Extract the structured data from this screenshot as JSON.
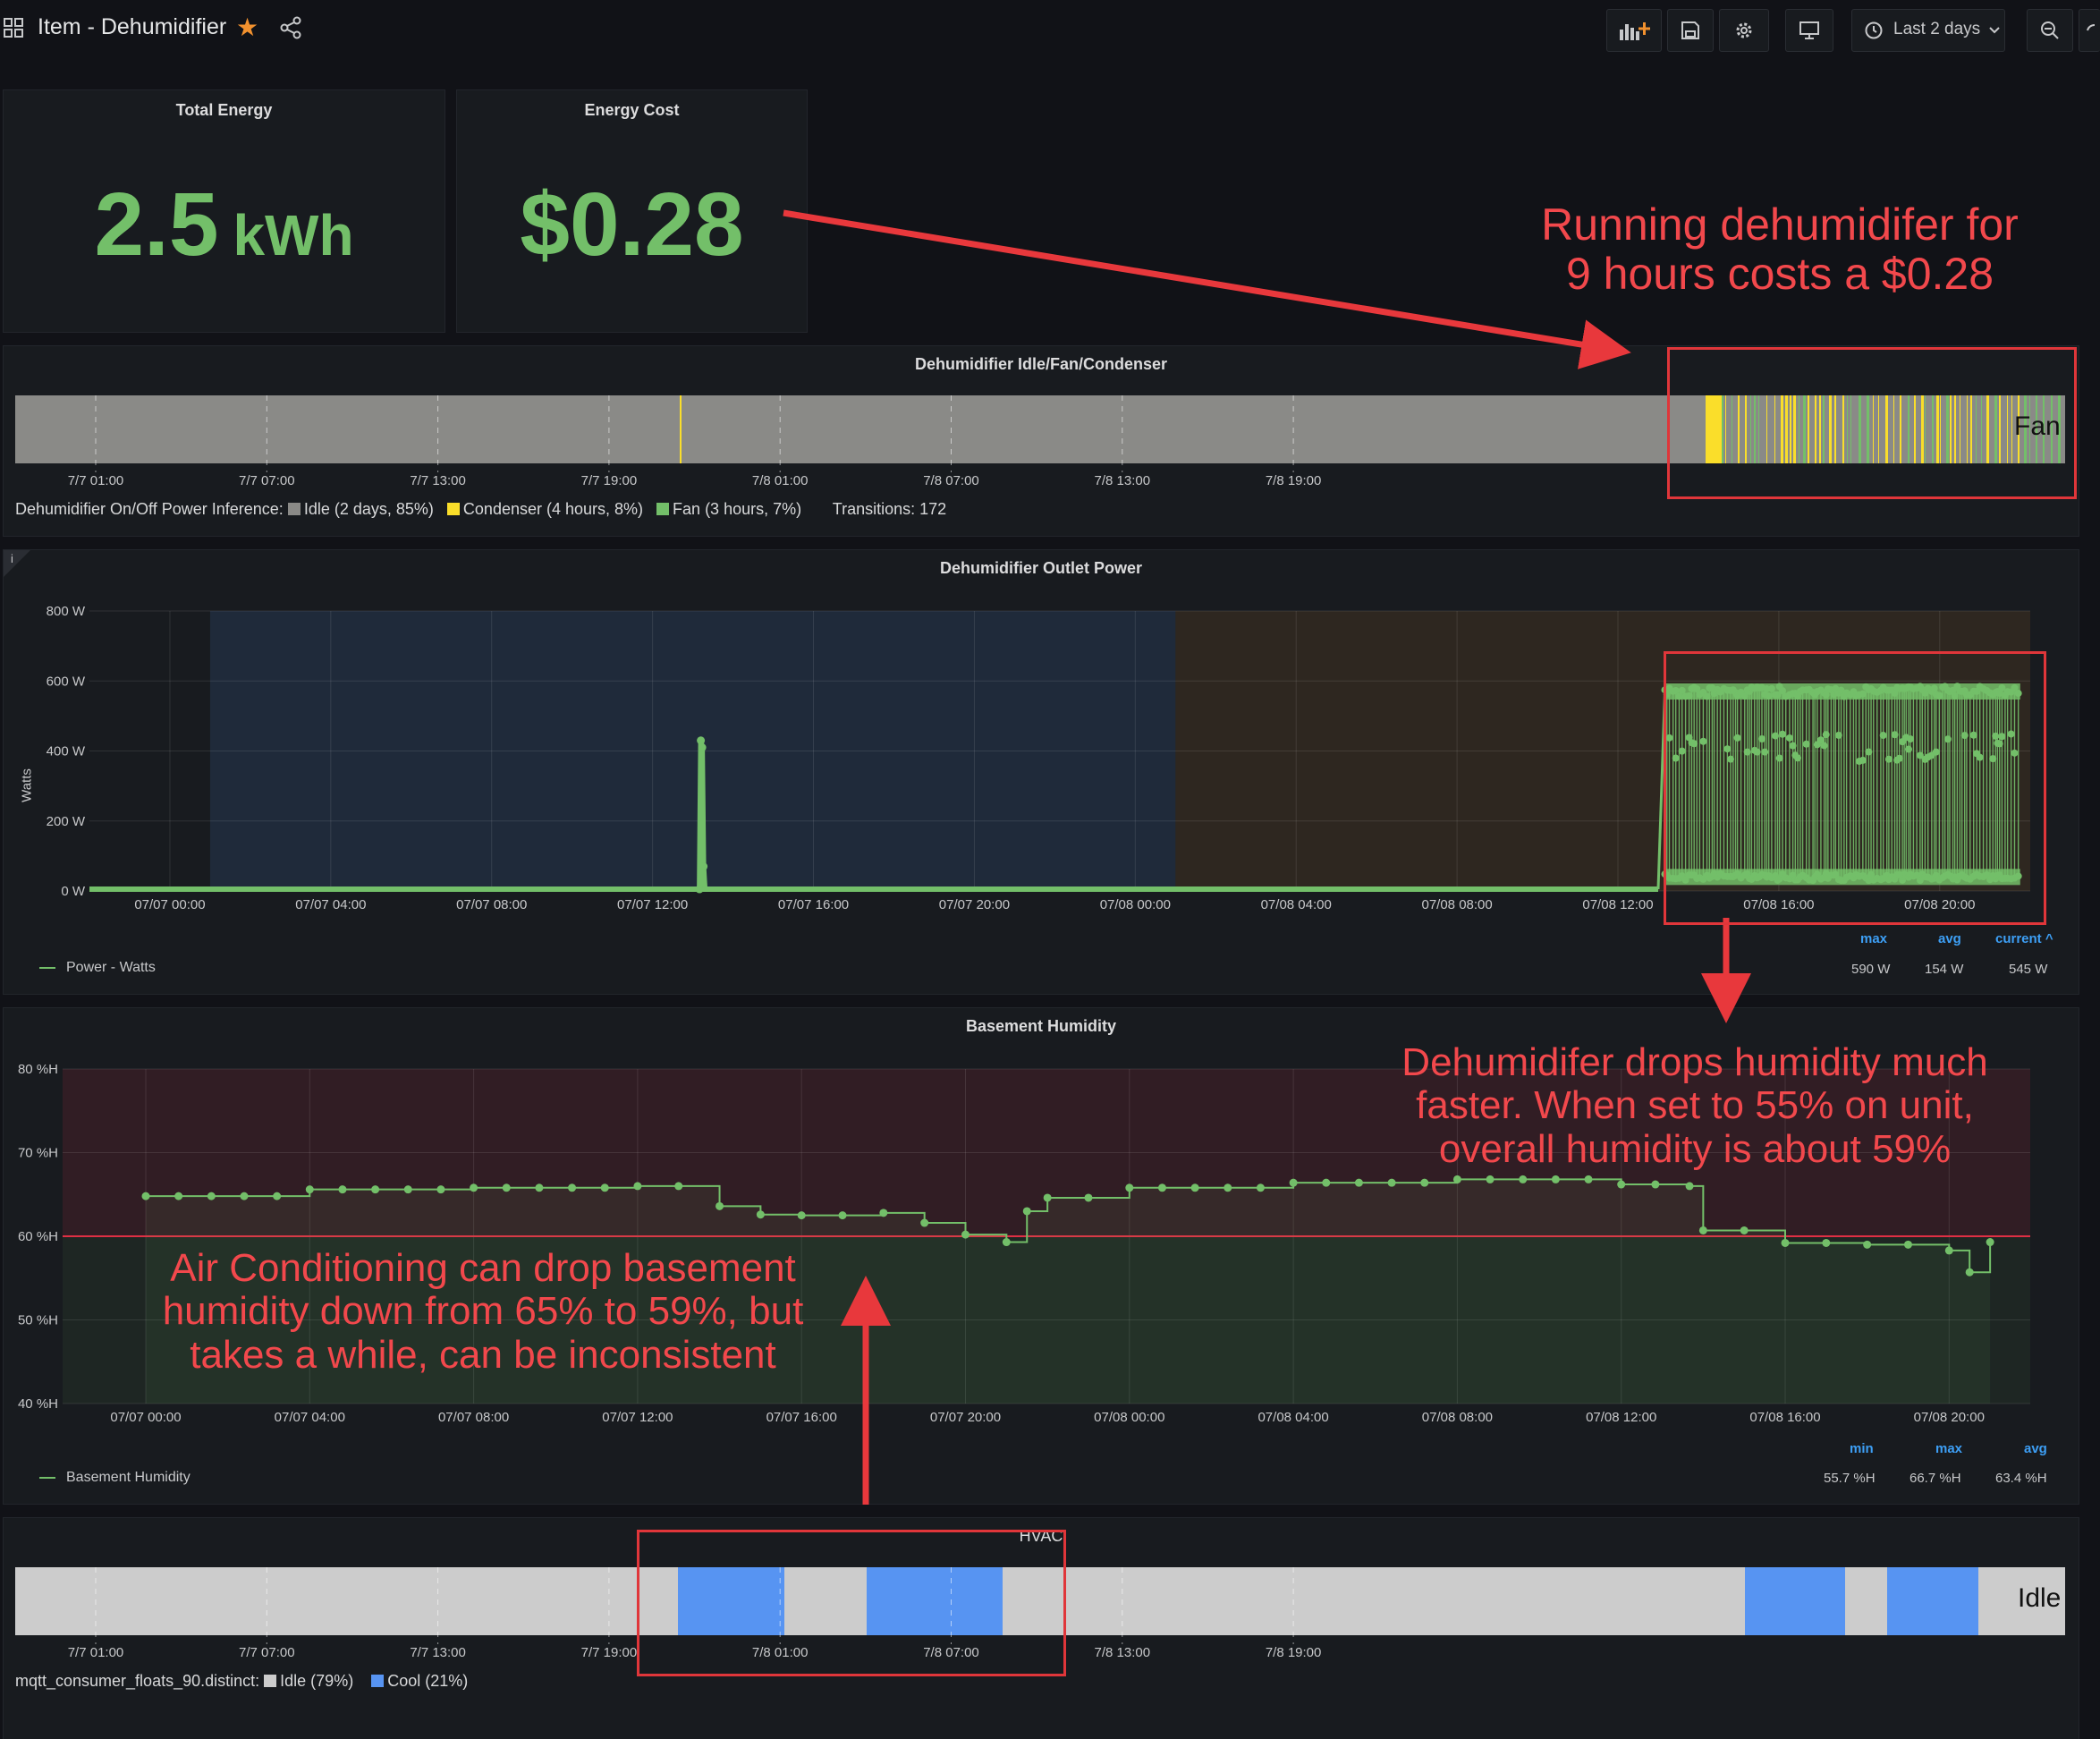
{
  "header": {
    "title": "Item - Dehumidifier",
    "time_range": "Last 2 days"
  },
  "stats": {
    "total_energy": {
      "title": "Total Energy",
      "value": "2.5",
      "unit": "kWh"
    },
    "energy_cost": {
      "title": "Energy Cost",
      "value": "$0.28"
    }
  },
  "state_panel": {
    "title": "Dehumidifier Idle/Fan/Condenser",
    "overlay_label": "Fan",
    "ticks": [
      "7/7 01:00",
      "7/7 07:00",
      "7/7 13:00",
      "7/7 19:00",
      "7/8 01:00",
      "7/8 07:00",
      "7/8 13:00",
      "7/8 19:00"
    ],
    "legend_prefix": "Dehumidifier On/Off Power Inference:",
    "legend": [
      {
        "label": "Idle (2 days, 85%)",
        "color": "#8a8a87"
      },
      {
        "label": "Condenser (4 hours, 8%)",
        "color": "#fade2a"
      },
      {
        "label": "Fan (3 hours, 7%)",
        "color": "#73bf69"
      }
    ],
    "transitions": "Transitions: 172"
  },
  "power_panel": {
    "title": "Dehumidifier Outlet Power",
    "info_glyph": "i",
    "ylabel": "Watts",
    "yticks": [
      "800 W",
      "600 W",
      "400 W",
      "200 W",
      "0 W"
    ],
    "xticks": [
      "07/07 00:00",
      "07/07 04:00",
      "07/07 08:00",
      "07/07 12:00",
      "07/07 16:00",
      "07/07 20:00",
      "07/08 00:00",
      "07/08 04:00",
      "07/08 08:00",
      "07/08 12:00",
      "07/08 16:00",
      "07/08 20:00"
    ],
    "legend_name": "Power - Watts",
    "stat_headers": [
      "max",
      "avg",
      "current ^"
    ],
    "stat_values": [
      "590 W",
      "154 W",
      "545 W"
    ]
  },
  "humidity_panel": {
    "title": "Basement Humidity",
    "yticks": [
      "80 %H",
      "70 %H",
      "60 %H",
      "50 %H",
      "40 %H"
    ],
    "xticks": [
      "07/07 00:00",
      "07/07 04:00",
      "07/07 08:00",
      "07/07 12:00",
      "07/07 16:00",
      "07/07 20:00",
      "07/08 00:00",
      "07/08 04:00",
      "07/08 08:00",
      "07/08 12:00",
      "07/08 16:00",
      "07/08 20:00"
    ],
    "legend_name": "Basement Humidity",
    "stat_headers": [
      "min",
      "max",
      "avg"
    ],
    "stat_values": [
      "55.7 %H",
      "66.7 %H",
      "63.4 %H"
    ]
  },
  "hvac_panel": {
    "title": "HVAC",
    "overlay_label": "Idle",
    "ticks": [
      "7/7 01:00",
      "7/7 07:00",
      "7/7 13:00",
      "7/7 19:00",
      "7/8 01:00",
      "7/8 07:00",
      "7/8 13:00",
      "7/8 19:00"
    ],
    "legend_prefix": "mqtt_consumer_floats_90.distinct:",
    "legend": [
      {
        "label": "Idle (79%)",
        "color": "#cccccc"
      },
      {
        "label": "Cool (21%)",
        "color": "#5794f2"
      }
    ]
  },
  "annotations": {
    "cost_note": [
      "Running dehumidifer for",
      "9 hours costs a $0.28"
    ],
    "dehumid_note": [
      "Dehumidifer drops humidity much",
      "faster.  When set to 55% on unit,",
      "overall humidity is about 59%"
    ],
    "ac_note": [
      "Air Conditioning can drop basement",
      "humidity down from 65% to 59%, but",
      "takes a while, can be inconsistent"
    ]
  },
  "colors": {
    "green": "#73bf69",
    "yellow": "#fade2a",
    "idle_gray": "#8a8a87",
    "hvac_idle": "#cccccc",
    "hvac_cool": "#5794f2",
    "annotation_red": "#f2484c"
  },
  "chart_data": [
    {
      "type": "line",
      "title": "Dehumidifier Outlet Power",
      "ylabel": "Watts",
      "ylim": [
        0,
        800
      ],
      "xlim": [
        "07/06 22:00",
        "07/08 22:15"
      ],
      "series": [
        {
          "name": "Power - Watts",
          "x": [
            "07/06 22:00",
            "07/07 13:10",
            "07/07 13:12",
            "07/07 13:14",
            "07/07 13:16",
            "07/07 13:18",
            "07/08 13:00",
            "07/08 13:10",
            "07/08 13:25",
            "07/08 14:00",
            "07/08 16:00",
            "07/08 18:00",
            "07/08 20:00",
            "07/08 22:00"
          ],
          "values": [
            5,
            5,
            430,
            410,
            70,
            5,
            5,
            570,
            590,
            580,
            570,
            560,
            570,
            545
          ]
        }
      ],
      "band_levels": [
        40,
        410,
        570
      ],
      "stats": {
        "max": "590 W",
        "avg": "154 W",
        "current": "545 W"
      }
    },
    {
      "type": "line",
      "title": "Basement Humidity",
      "ylim": [
        40,
        80
      ],
      "threshold": 60,
      "xlim": [
        "07/06 22:30",
        "07/08 22:00"
      ],
      "series": [
        {
          "name": "Basement Humidity",
          "x": [
            "07/07 00:00",
            "07/07 04:00",
            "07/07 08:00",
            "07/07 12:00",
            "07/07 14:00",
            "07/07 15:00",
            "07/07 16:00",
            "07/07 18:00",
            "07/07 19:00",
            "07/07 20:00",
            "07/07 21:00",
            "07/07 21:30",
            "07/07 22:00",
            "07/08 00:00",
            "07/08 04:00",
            "07/08 08:00",
            "07/08 12:00",
            "07/08 13:40",
            "07/08 14:00",
            "07/08 16:00",
            "07/08 18:00",
            "07/08 20:00",
            "07/08 20:30",
            "07/08 21:00"
          ],
          "values": [
            64.8,
            65.6,
            65.8,
            66.0,
            63.6,
            62.6,
            62.5,
            62.8,
            61.6,
            60.2,
            59.3,
            63.0,
            64.6,
            65.8,
            66.4,
            66.8,
            66.2,
            66.0,
            60.7,
            59.2,
            59.0,
            58.3,
            55.7,
            59.3
          ]
        }
      ],
      "stats": {
        "min": "55.7 %H",
        "max": "66.7 %H",
        "avg": "63.4 %H"
      }
    }
  ]
}
